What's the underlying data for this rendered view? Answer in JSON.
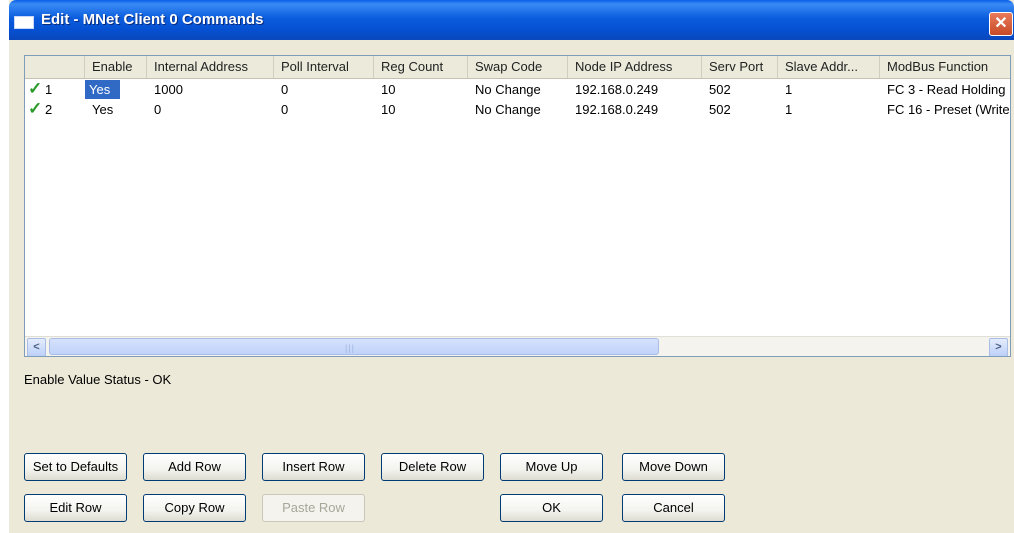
{
  "window": {
    "title": "Edit - MNet Client 0 Commands",
    "close_glyph": "✕"
  },
  "grid": {
    "columns": [
      "",
      "Enable",
      "Internal Address",
      "Poll Interval",
      "Reg Count",
      "Swap Code",
      "Node IP Address",
      "Serv Port",
      "Slave Addr...",
      "ModBus Function"
    ],
    "rows": [
      {
        "check": "✓",
        "num": "1",
        "enable": "Yes",
        "internal_address": "1000",
        "poll_interval": "0",
        "reg_count": "10",
        "swap_code": "No Change",
        "node_ip": "192.168.0.249",
        "serv_port": "502",
        "slave_addr": "1",
        "modbus_function": "FC 3 - Read Holding"
      },
      {
        "check": "✓",
        "num": "2",
        "enable": "Yes",
        "internal_address": "0",
        "poll_interval": "0",
        "reg_count": "10",
        "swap_code": "No Change",
        "node_ip": "192.168.0.249",
        "serv_port": "502",
        "slave_addr": "1",
        "modbus_function": "FC 16 - Preset (Write"
      }
    ],
    "scroll_left_glyph": "<",
    "scroll_right_glyph": ">",
    "scroll_grip": "|||"
  },
  "status_text": "Enable Value Status - OK",
  "buttons": {
    "set_to_defaults": "Set to Defaults",
    "add_row": "Add Row",
    "insert_row": "Insert Row",
    "delete_row": "Delete Row",
    "move_up": "Move Up",
    "move_down": "Move Down",
    "edit_row": "Edit Row",
    "copy_row": "Copy Row",
    "paste_row": "Paste Row",
    "ok": "OK",
    "cancel": "Cancel"
  },
  "colors": {
    "title_bar": "#0b5ddd",
    "selection": "#316ac5",
    "check_mark": "#2a9a2a",
    "dialog_bg": "#ece9d8"
  }
}
